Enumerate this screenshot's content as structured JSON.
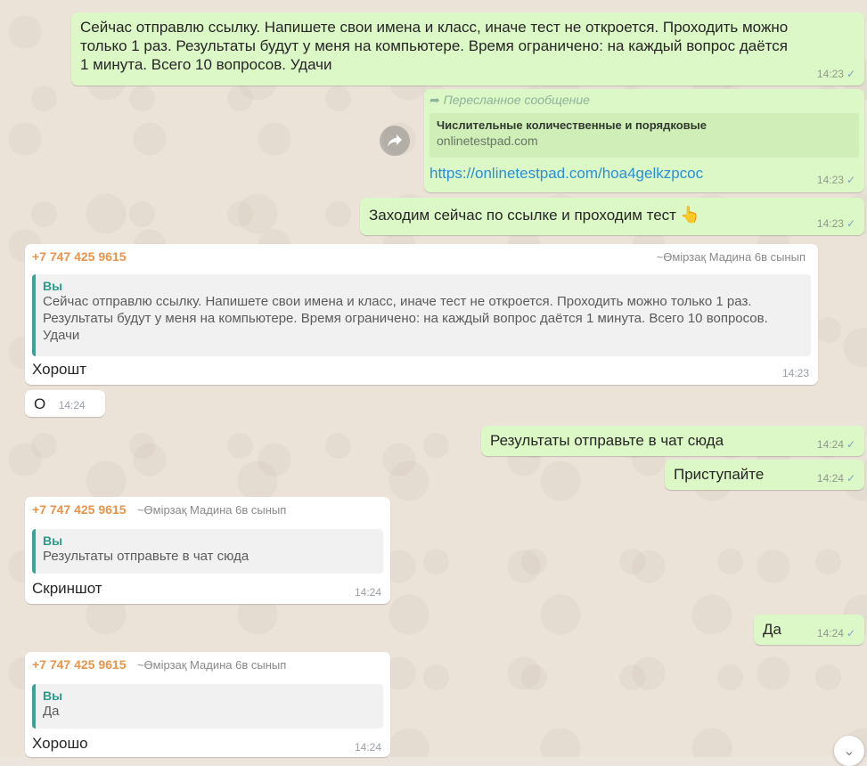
{
  "messages": {
    "m1": {
      "text": "Сейчас отправлю ссылку. Напишете свои имена и класс, иначе тест не откроется. Проходить можно только 1 раз. Результаты будут у меня на компьютере. Время ограничено: на каждый вопрос даётся 1 минута. Всего 10 вопросов. Удачи",
      "time": "14:23"
    },
    "m2": {
      "forwarded_label": "Пересланное сообщение",
      "link_title": "Числительные количественные и порядковые",
      "link_domain": "onlinetestpad.com",
      "url": "https://onlinetestpad.com/hoa4gelkzpcoc",
      "time": "14:23"
    },
    "m3": {
      "text": "Заходим сейчас по ссылке и проходим тест",
      "emoji": "👆",
      "time": "14:23"
    },
    "m4": {
      "sender": "+7 747 425 9615",
      "pushname": "~Өмірзақ Мадина 6в сынып",
      "quote_author": "Вы",
      "quote_text": "Сейчас отправлю ссылку. Напишете свои имена и класс, иначе тест не откроется. Проходить можно только 1 раз. Результаты будут у меня на компьютере. Время ограничено: на каждый вопрос даётся 1 минута. Всего 10 вопросов. Удачи",
      "text": "Хорошт",
      "time": "14:23"
    },
    "m5": {
      "text": "О",
      "time": "14:24"
    },
    "m6": {
      "text": "Результаты отправьте в чат сюда",
      "time": "14:24"
    },
    "m7": {
      "text": "Приступайте",
      "time": "14:24"
    },
    "m8": {
      "sender": "+7 747 425 9615",
      "pushname": "~Өмірзақ Мадина 6в сынып",
      "quote_author": "Вы",
      "quote_text": "Результаты отправьте в чат сюда",
      "text": "Скриншот",
      "time": "14:24"
    },
    "m9": {
      "text": "Да",
      "time": "14:24"
    },
    "m10": {
      "sender": "+7 747 425 9615",
      "pushname": "~Өмірзақ Мадина 6в сынып",
      "quote_author": "Вы",
      "quote_text": "Да",
      "text": "Хорошо",
      "time": "14:24"
    }
  },
  "icons": {
    "read_check": "✓",
    "forward_share": "share-arrow",
    "forwarded_arrow": "➦",
    "scroll_down": "⌄"
  },
  "colors": {
    "outgoing_bubble": "#dcf8c6",
    "incoming_bubble": "#ffffff",
    "sender_name": "#e8944a",
    "quote_accent": "#35a597",
    "link": "#2a8fd6"
  }
}
